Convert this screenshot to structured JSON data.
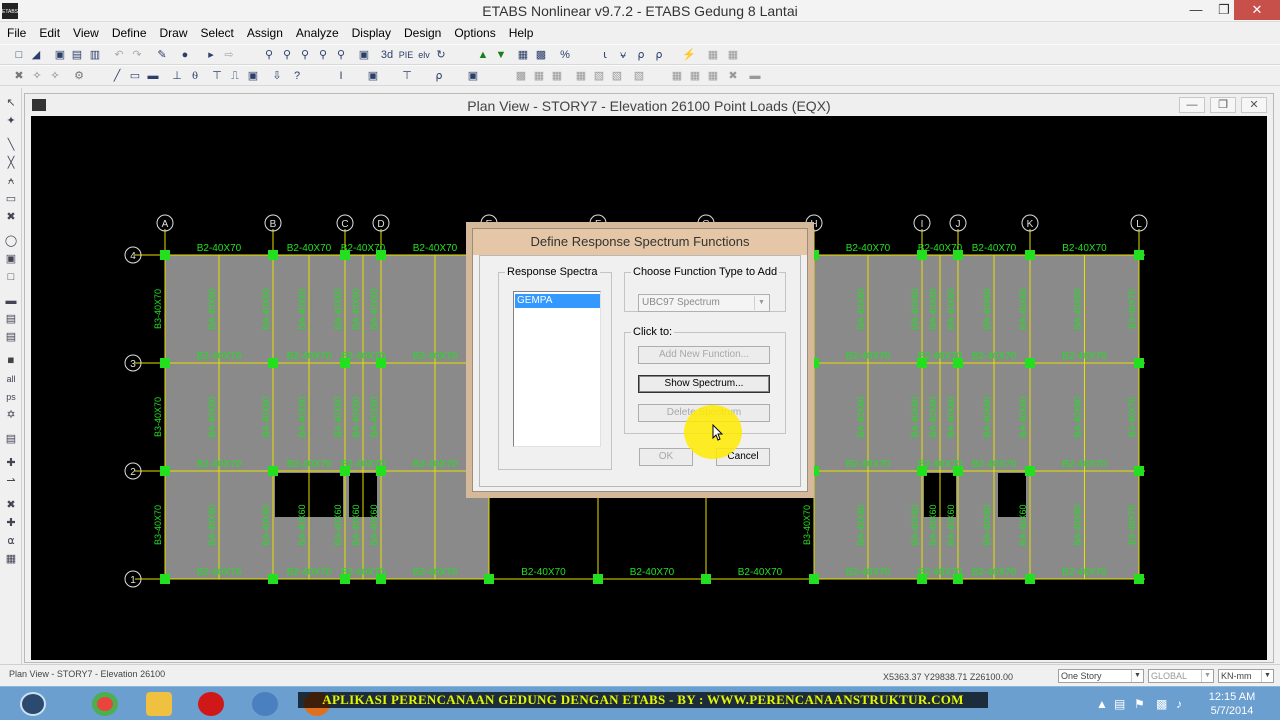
{
  "window": {
    "title": "ETABS Nonlinear v9.7.2 - ETABS Gedung 8 Lantai",
    "app_icon_text": "ETABS"
  },
  "menu": [
    "File",
    "Edit",
    "View",
    "Define",
    "Draw",
    "Select",
    "Assign",
    "Analyze",
    "Display",
    "Design",
    "Options",
    "Help"
  ],
  "toolbar": {
    "view_3d_label": "3d",
    "plan_label": "PIE",
    "elev_label": "elv"
  },
  "plan_window": {
    "title": "Plan View - STORY7 - Elevation 26100  Point Loads (EQX)"
  },
  "grid": {
    "columns": [
      "A",
      "B",
      "C",
      "D",
      "E",
      "F",
      "G",
      "H",
      "I",
      "J",
      "K",
      "L"
    ],
    "rows": [
      "4",
      "3",
      "2",
      "1"
    ],
    "beam_labels": {
      "top": "B2-40X70",
      "bottom_middle": "B2-40X70",
      "vertical_edge": "B3-40X70",
      "vertical_inner": "BA-40X60",
      "opening": "BA-40X60"
    },
    "colors": {
      "background": "#000000",
      "grid": "#e8e000",
      "slab": "#8a8a8a",
      "label": "#22e020",
      "node": "#22e020",
      "bubble": "#e0e0e0"
    }
  },
  "dialog": {
    "title": "Define Response Spectrum Functions",
    "response_spectra_legend": "Response Spectra",
    "spectra_items": [
      "GEMPA"
    ],
    "choose_type_legend": "Choose  Function Type to Add",
    "function_type": "UBC97 Spectrum",
    "click_to_legend": "Click to:",
    "add_new_label": "Add New Function...",
    "show_label": "Show Spectrum...",
    "delete_label": "Delete Spectrum",
    "ok_label": "OK",
    "cancel_label": "Cancel"
  },
  "status": {
    "left_text": "Plan View - STORY7 - Elevation 26100",
    "coords": "X5363.37  Y29838.71  Z26100.00",
    "story_select": "One Story",
    "coord_system": "GLOBAL",
    "units": "KN-mm"
  },
  "taskbar": {
    "banner": "APLIKASI PERENCANAAN GEDUNG DENGAN ETABS - BY : WWW.PERENCANAANSTRUKTUR.COM",
    "time": "12:15 AM",
    "date": "5/7/2014"
  }
}
